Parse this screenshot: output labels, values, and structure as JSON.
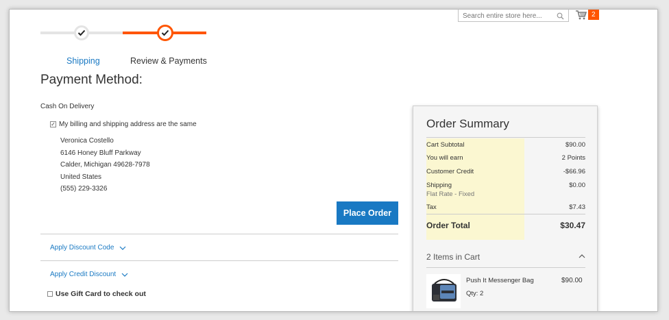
{
  "header": {
    "search_placeholder": "Search entire store here...",
    "cart_count": "2"
  },
  "progress": {
    "steps": [
      {
        "label": "Shipping",
        "state": "complete"
      },
      {
        "label": "Review & Payments",
        "state": "active"
      }
    ],
    "colors": {
      "inactive": "#e4e4e4",
      "active": "#ff5501",
      "link": "#1979c3"
    }
  },
  "payment": {
    "title": "Payment Method:",
    "method_name": "Cash On Delivery",
    "same_address_label": "My billing and shipping address are the same",
    "same_address_checked": true,
    "address": [
      "Veronica Costello",
      "6146 Honey Bluff Parkway",
      "Calder, Michigan 49628-7978",
      "United States",
      "(555) 229-3326"
    ],
    "place_order_label": "Place Order",
    "discount_label": "Apply Discount Code",
    "credit_label": "Apply Credit Discount",
    "giftcard_label": "Use Gift Card to check out"
  },
  "summary": {
    "title": "Order Summary",
    "rows": [
      {
        "label": "Cart Subtotal",
        "value": "$90.00"
      },
      {
        "label": "You will earn",
        "value": "2 Points"
      },
      {
        "label": "Customer Credit",
        "value": "-$66.96"
      },
      {
        "label": "Shipping",
        "sublabel": "Flat Rate - Fixed",
        "value": "$0.00"
      },
      {
        "label": "Tax",
        "value": "$7.43"
      }
    ],
    "total_label": "Order Total",
    "total_value": "$30.47",
    "items_heading": "2 Items in Cart",
    "item": {
      "name": "Push It Messenger Bag",
      "qty": "Qty: 2",
      "price": "$90.00"
    }
  }
}
